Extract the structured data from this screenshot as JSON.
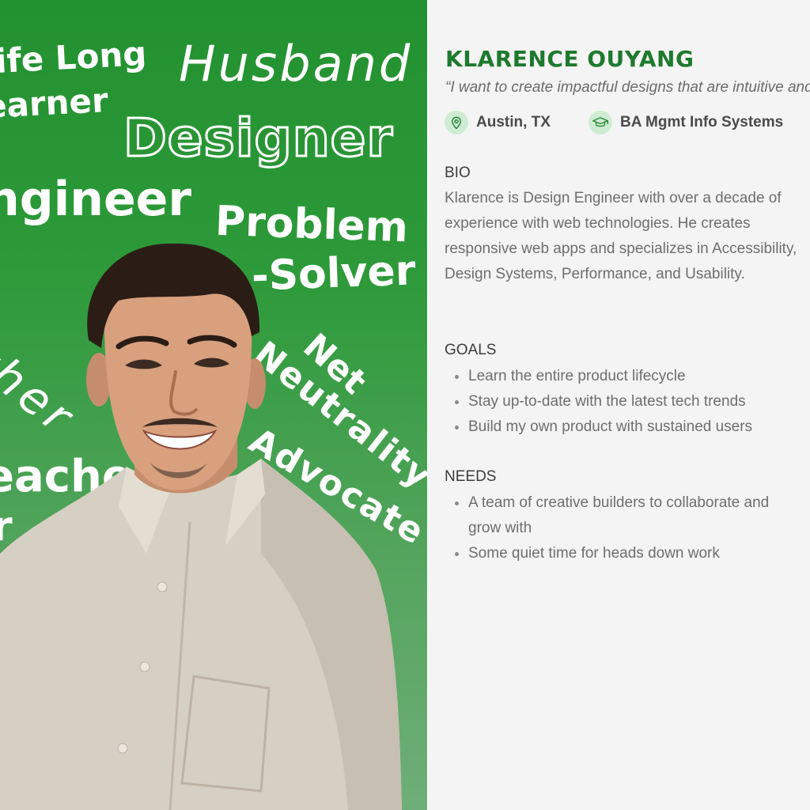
{
  "hero": {
    "words": {
      "lifelong": "ife Long",
      "learner": "earner",
      "husband": "Husband",
      "designer": "Designer",
      "engineer": "ngineer",
      "problem": "Problem",
      "solver": "-Solver",
      "father": "ather",
      "net": "Net",
      "neutrality": "Neutrality",
      "advocate": "Advocate",
      "teacher": "eacher",
      "er": "r"
    }
  },
  "persona": {
    "name": "KLARENCE OUYANG",
    "quote": "“I want to create impactful designs that are intuitive and accessible.”",
    "location": "Austin, TX",
    "education": "BA Mgmt Info Systems"
  },
  "bio": {
    "heading": "BIO",
    "text": "Klarence is Design Engineer with over a decade of experience with web technologies. He creates responsive web apps and specializes in Accessibility, Design Systems, Performance, and Usability."
  },
  "goals": {
    "heading": "GOALS",
    "items": [
      "Learn the entire product lifecycle",
      "Stay up-to-date with the latest tech trends",
      "Build my own product with sustained users"
    ]
  },
  "needs": {
    "heading": "NEEDS",
    "items": [
      "A team of creative builders to collaborate and grow with",
      "Some quiet time for heads down work"
    ]
  },
  "icons": {
    "location": "map-pin-icon",
    "education": "graduation-cap-icon"
  },
  "colors": {
    "accent": "#1e7a2d",
    "panel_green": "#2e9a3a",
    "icon_bg": "#cfecd3",
    "body_text": "#6e6e6e"
  }
}
